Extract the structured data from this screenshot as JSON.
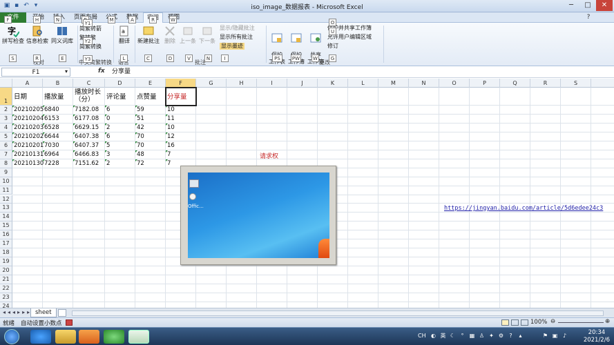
{
  "window": {
    "title": "iso_image_数据报表 - Microsoft Excel"
  },
  "tabs": [
    "文件",
    "开始",
    "插入",
    "页面布局",
    "公式",
    "数据",
    "审阅",
    "视图"
  ],
  "ribbon": {
    "spell": "拼写检查",
    "research": "信息检索",
    "thesaurus": "同义词库",
    "jian_fan": "简繁转箭",
    "fan_jian": "繁转繁",
    "jianfan_convert": "简繁转换",
    "translate": "翻译",
    "new_comment": "新建批注",
    "delete": "删除",
    "prev": "上一条",
    "next": "下一条",
    "show_hide": "显示/隐藏批注",
    "show_all": "显示所有批注",
    "show_ink": "显示墨迹",
    "protect_sheet": "保护\n工作表",
    "protect_wb": "保护\n工作簿",
    "share_wb": "共享\n工作簿",
    "protect_share": "保护并共享工作簿",
    "allow_edit": "允许用户编辑区域",
    "track": "修订",
    "g_proof": "校对",
    "g_chinese": "中文简繁转换",
    "g_lang": "语言",
    "g_comment": "批注",
    "g_change": "更改"
  },
  "keytips": [
    "F",
    "H",
    "N",
    "P",
    "M",
    "A",
    "R",
    "W",
    "Y1",
    "Y2",
    "Y3",
    "S",
    "R",
    "E",
    "L",
    "C",
    "D",
    "V",
    "N",
    "I",
    "PS",
    "PW",
    "W",
    "O",
    "U",
    "G"
  ],
  "formula": {
    "name": "F1",
    "fx": "fx",
    "content": "分享量"
  },
  "columns": [
    "A",
    "B",
    "C",
    "D",
    "E",
    "F",
    "G",
    "H",
    "I",
    "J",
    "K",
    "L",
    "M",
    "N",
    "O",
    "P",
    "Q",
    "R",
    "S"
  ],
  "rows": [
    "1",
    "2",
    "3",
    "4",
    "5",
    "6",
    "7",
    "8",
    "9",
    "10",
    "11",
    "12",
    "13",
    "14",
    "15",
    "16",
    "17",
    "18",
    "19",
    "20",
    "21",
    "22",
    "23",
    "24"
  ],
  "headers": [
    "日期",
    "播放量",
    "播放时长（分）",
    "评论量",
    "点赞量",
    "分享量"
  ],
  "data": [
    [
      "20210205",
      "6840",
      "7182.08",
      "6",
      "59",
      "10"
    ],
    [
      "20210204",
      "6153",
      "6177.08",
      "0",
      "51",
      "11"
    ],
    [
      "20210203",
      "6528",
      "6629.15",
      "2",
      "42",
      "10"
    ],
    [
      "20210202",
      "6644",
      "6407.38",
      "6",
      "70",
      "12"
    ],
    [
      "20210201",
      "7030",
      "6407.37",
      "5",
      "70",
      "16"
    ],
    [
      "20210131",
      "6964",
      "6466.83",
      "3",
      "48",
      "7"
    ],
    [
      "20210130",
      "7228",
      "7151.62",
      "2",
      "72",
      "7"
    ]
  ],
  "request_text": "请求权",
  "link": "https://jingyan.baidu.com/article/5d6edee24c3",
  "preview": {
    "label": "Offic..."
  },
  "sheet": {
    "name": "sheet"
  },
  "status": {
    "ready": "就绪",
    "autocalc": "自动设置小数点",
    "zoom": "100%"
  },
  "clock": {
    "time": "20:34",
    "date": "2021/2/6"
  },
  "tray": {
    "ch": "CH"
  }
}
